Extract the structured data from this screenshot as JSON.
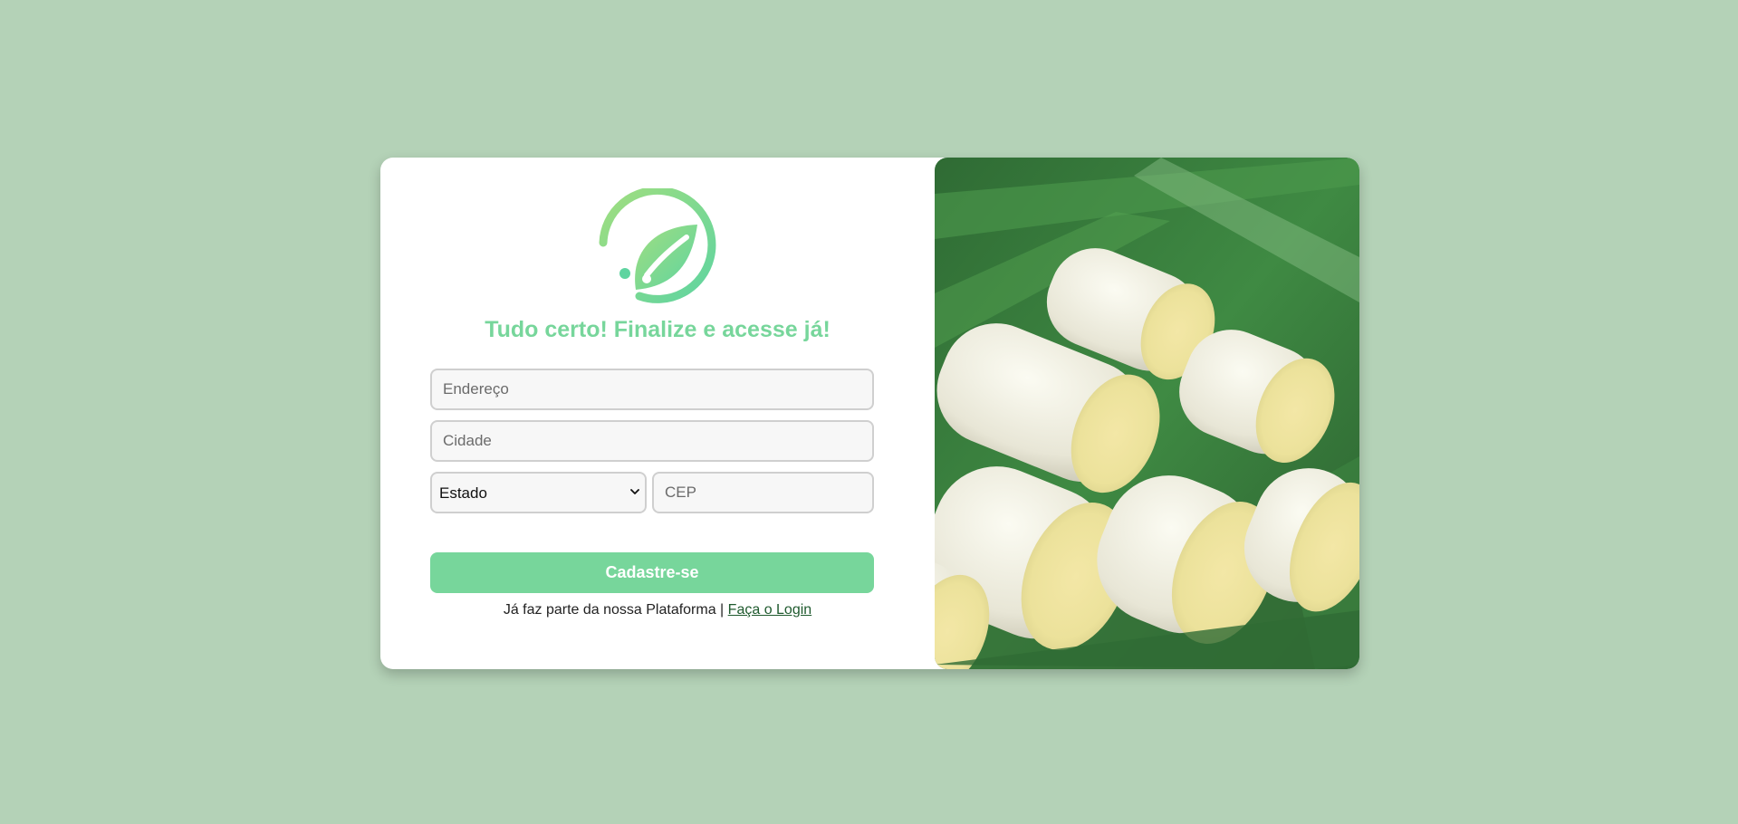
{
  "form": {
    "title": "Tudo certo! Finalize e acesse já!",
    "address_placeholder": "Endereço",
    "city_placeholder": "Cidade",
    "state_selected": "Estado",
    "zip_placeholder": "CEP",
    "submit_label": "Cadastre-se",
    "login_prompt": "Já faz parte da nossa Plataforma |",
    "login_link": "Faça o Login"
  },
  "icons": {
    "logo": "leaf-logo-icon",
    "select_arrow": "chevron-down-icon"
  },
  "colors": {
    "background": "#b4d2b7",
    "accent": "#77d69b",
    "link": "#1f5a2e",
    "card": "#ffffff"
  }
}
